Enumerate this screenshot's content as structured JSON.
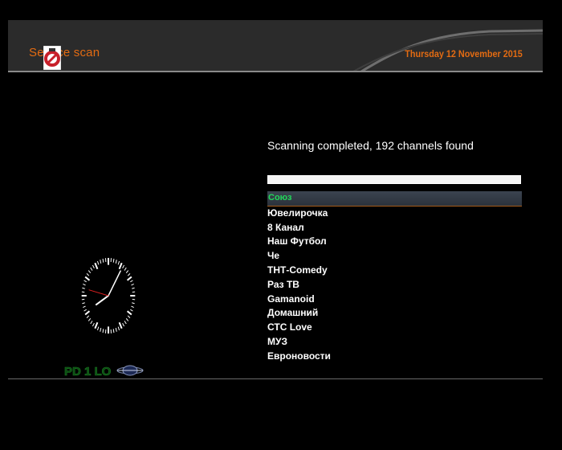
{
  "header": {
    "title": "Service scan",
    "date": "Thursday 12 November 2015"
  },
  "scan": {
    "status": "Scanning completed, 192 channels found",
    "progress": 1.0
  },
  "channels": [
    "Союз",
    "Ювелирочка",
    "8 Канал",
    "Наш Футбол",
    "Че",
    "ТНТ-Comedy",
    "Раз ТВ",
    "Gamanoid",
    "Домашний",
    "СТС Love",
    "МУЗ",
    "Евроновости"
  ],
  "selected_channel_index": 0,
  "clock": {
    "hour": 8,
    "minute": 5,
    "second": 47
  },
  "branding": {
    "logo_text": "PD 1 LO"
  },
  "colors": {
    "accent": "#e36b12",
    "selected_text": "#21d85a",
    "header_bg": "#2b2b2b"
  },
  "icons": {
    "clock": "analog-clock-icon",
    "logo": "satellite-logo-icon"
  }
}
